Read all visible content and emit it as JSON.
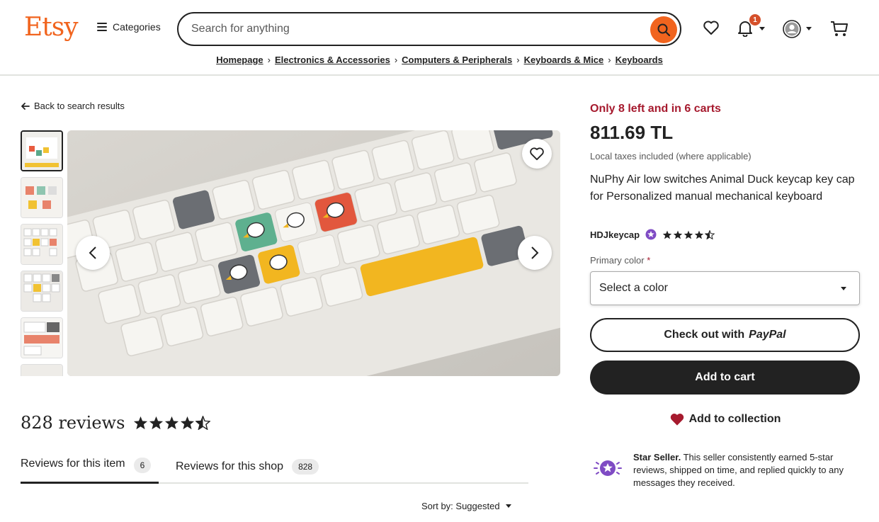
{
  "header": {
    "logo": "Etsy",
    "categories_label": "Categories",
    "search_placeholder": "Search for anything",
    "notification_count": "1"
  },
  "breadcrumb": [
    "Homepage",
    "Electronics & Accessories",
    "Computers & Peripherals",
    "Keyboards & Mice",
    "Keyboards"
  ],
  "left": {
    "back_link": "Back to search results",
    "reviews_count_title": "828 reviews",
    "review_rating": 4.5,
    "tabs": [
      {
        "label": "Reviews for this item",
        "count": "6"
      },
      {
        "label": "Reviews for this shop",
        "count": "828"
      }
    ],
    "sort_label": "Sort by: Suggested"
  },
  "product": {
    "stock_notice": "Only 8 left and in 6 carts",
    "price": "811.69 TL",
    "tax_note": "Local taxes included (where applicable)",
    "title": "NuPhy Air low switches Animal Duck keycap key cap for Personalized manual mechanical keyboard",
    "shop_name": "HDJkeycap",
    "shop_rating": 4.5,
    "color_label": "Primary color",
    "color_required_mark": "*",
    "color_select_value": "Select a color",
    "paypal_prefix": "Check out with",
    "paypal_brand": "PayPal",
    "add_to_cart": "Add to cart",
    "add_to_collection": "Add to collection",
    "star_seller_title": "Star Seller.",
    "star_seller_text": "This seller consistently earned 5-star reviews, shipped on time, and replied quickly to any messages they received."
  },
  "colors": {
    "brand": "#f1641e",
    "stock_red": "#a61a2e",
    "star_purple": "#7f4bc4"
  }
}
